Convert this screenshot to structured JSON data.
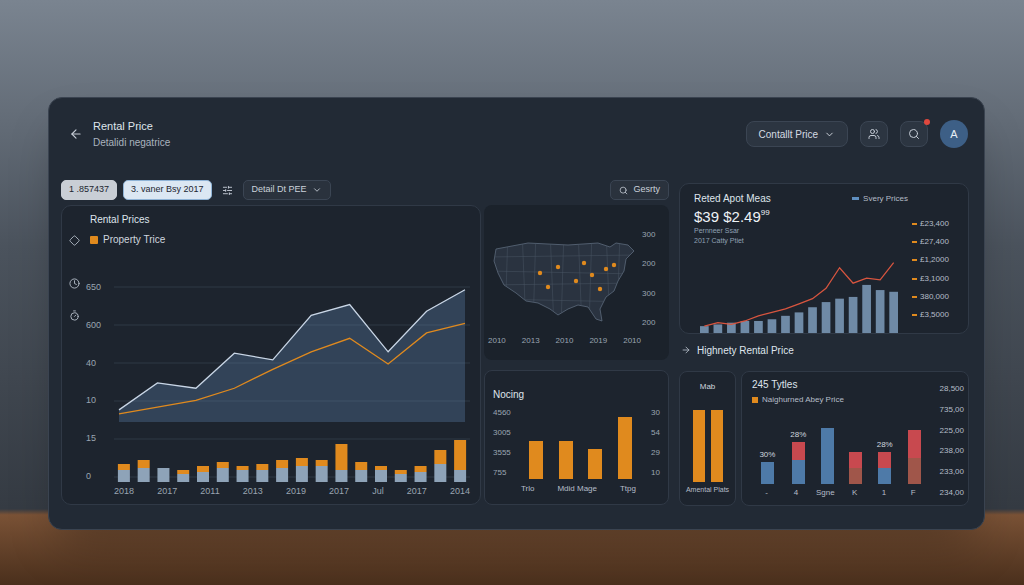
{
  "header": {
    "title": "Rental Price",
    "subtitle": "Detalidi negatrice",
    "dropdown": "Contallt Price",
    "avatar": "A",
    "notification": true
  },
  "filters": {
    "chips": [
      {
        "label": "1 .857437",
        "selected": false
      },
      {
        "label": "3. vaner Bsy 2017",
        "selected": true
      }
    ],
    "dropdown": "Detail Dt PEE",
    "search": "Gesrty"
  },
  "rental_chart": {
    "title": "Rental Prices",
    "legend": [
      {
        "label": "Property Trice",
        "color": "#e08a1e"
      }
    ],
    "y_ticks": [
      "650",
      "600",
      "40",
      "10",
      "15",
      "0"
    ],
    "x_labels": [
      "2018",
      "2017",
      "2011",
      "2013",
      "2019",
      "2017",
      "Jul",
      "2017",
      "2014"
    ],
    "max": 100,
    "lines": [
      {
        "color": "#c9d6e6",
        "values": [
          9,
          29,
          25,
          51,
          46,
          79,
          87,
          52,
          82,
          98
        ]
      },
      {
        "color": "#e08a1e",
        "values": [
          6,
          11,
          16,
          25,
          39,
          52,
          62,
          43,
          66,
          73
        ]
      }
    ],
    "bars": {
      "max": 50,
      "base": [
        12,
        14,
        14,
        8,
        10,
        14,
        12,
        12,
        14,
        16,
        16,
        12,
        12,
        12,
        8,
        10,
        18,
        12
      ],
      "top": [
        6,
        8,
        0,
        4,
        6,
        6,
        4,
        6,
        8,
        8,
        6,
        26,
        8,
        4,
        4,
        6,
        14,
        30
      ]
    }
  },
  "map": {
    "y_ticks": [
      "300",
      "200",
      "300",
      "200"
    ],
    "x_labels": [
      "2010",
      "2013",
      "2010",
      "2019",
      "2010"
    ]
  },
  "rent_meas": {
    "title": "Reted Apot Meas",
    "legend": "Svery Prices",
    "value": "$39 $2.49",
    "value_sup": "99",
    "sub": [
      "Pernneer Ssar",
      "2017 Catty Ptiet"
    ],
    "y_ticks": [
      "£23,400",
      "£27,400",
      "£1,2000",
      "£3,1000",
      "380,000",
      "£3,5000"
    ],
    "max": 90,
    "bars": [
      8,
      10,
      12,
      14,
      14,
      16,
      20,
      24,
      30,
      36,
      40,
      42,
      56,
      50,
      48
    ],
    "line": [
      8,
      12,
      10,
      14,
      20,
      24,
      28,
      34,
      40,
      52,
      76,
      58,
      64,
      62,
      82
    ]
  },
  "highest": {
    "title": "Highnety Rental Price"
  },
  "nocing": {
    "title": "Nocing",
    "left_ticks": [
      "4560",
      "3005",
      "3555",
      "755"
    ],
    "right_ticks": [
      "30",
      "54",
      "29",
      "10"
    ],
    "max": 70,
    "bars": [
      38,
      38,
      30,
      62
    ],
    "labels": [
      "Trlo",
      "Mdid Mage",
      "Ttpg"
    ]
  },
  "amenities": {
    "title": "Mab",
    "max": 100,
    "bars": [
      85,
      85
    ],
    "label": "Amental Plats"
  },
  "types": {
    "title": "245 Tytles",
    "legend": "Naighurned Abey Price",
    "max": 70,
    "y_ticks": [
      "28,500",
      "735,00",
      "225,00",
      "238,00",
      "233,00",
      "234,00"
    ],
    "bars": [
      {
        "label": "-",
        "note": "30%",
        "stack": [
          {
            "value": 22,
            "color": "#4e7aa8"
          }
        ]
      },
      {
        "label": "4",
        "note": "28%",
        "stack": [
          {
            "value": 24,
            "color": "#4e7aa8"
          },
          {
            "value": 18,
            "color": "#c8494f"
          }
        ]
      },
      {
        "label": "Sgne",
        "stack": [
          {
            "value": 56,
            "color": "#4e7aa8"
          }
        ]
      },
      {
        "label": "K",
        "stack": [
          {
            "value": 16,
            "color": "#a0564a"
          },
          {
            "value": 16,
            "color": "#c8494f"
          }
        ]
      },
      {
        "label": "1",
        "note": "28%",
        "stack": [
          {
            "value": 16,
            "color": "#4e7aa8"
          },
          {
            "value": 16,
            "color": "#c8494f"
          }
        ]
      },
      {
        "label": "F",
        "stack": [
          {
            "value": 26,
            "color": "#a0564a"
          },
          {
            "value": 28,
            "color": "#c8494f"
          }
        ]
      }
    ]
  }
}
